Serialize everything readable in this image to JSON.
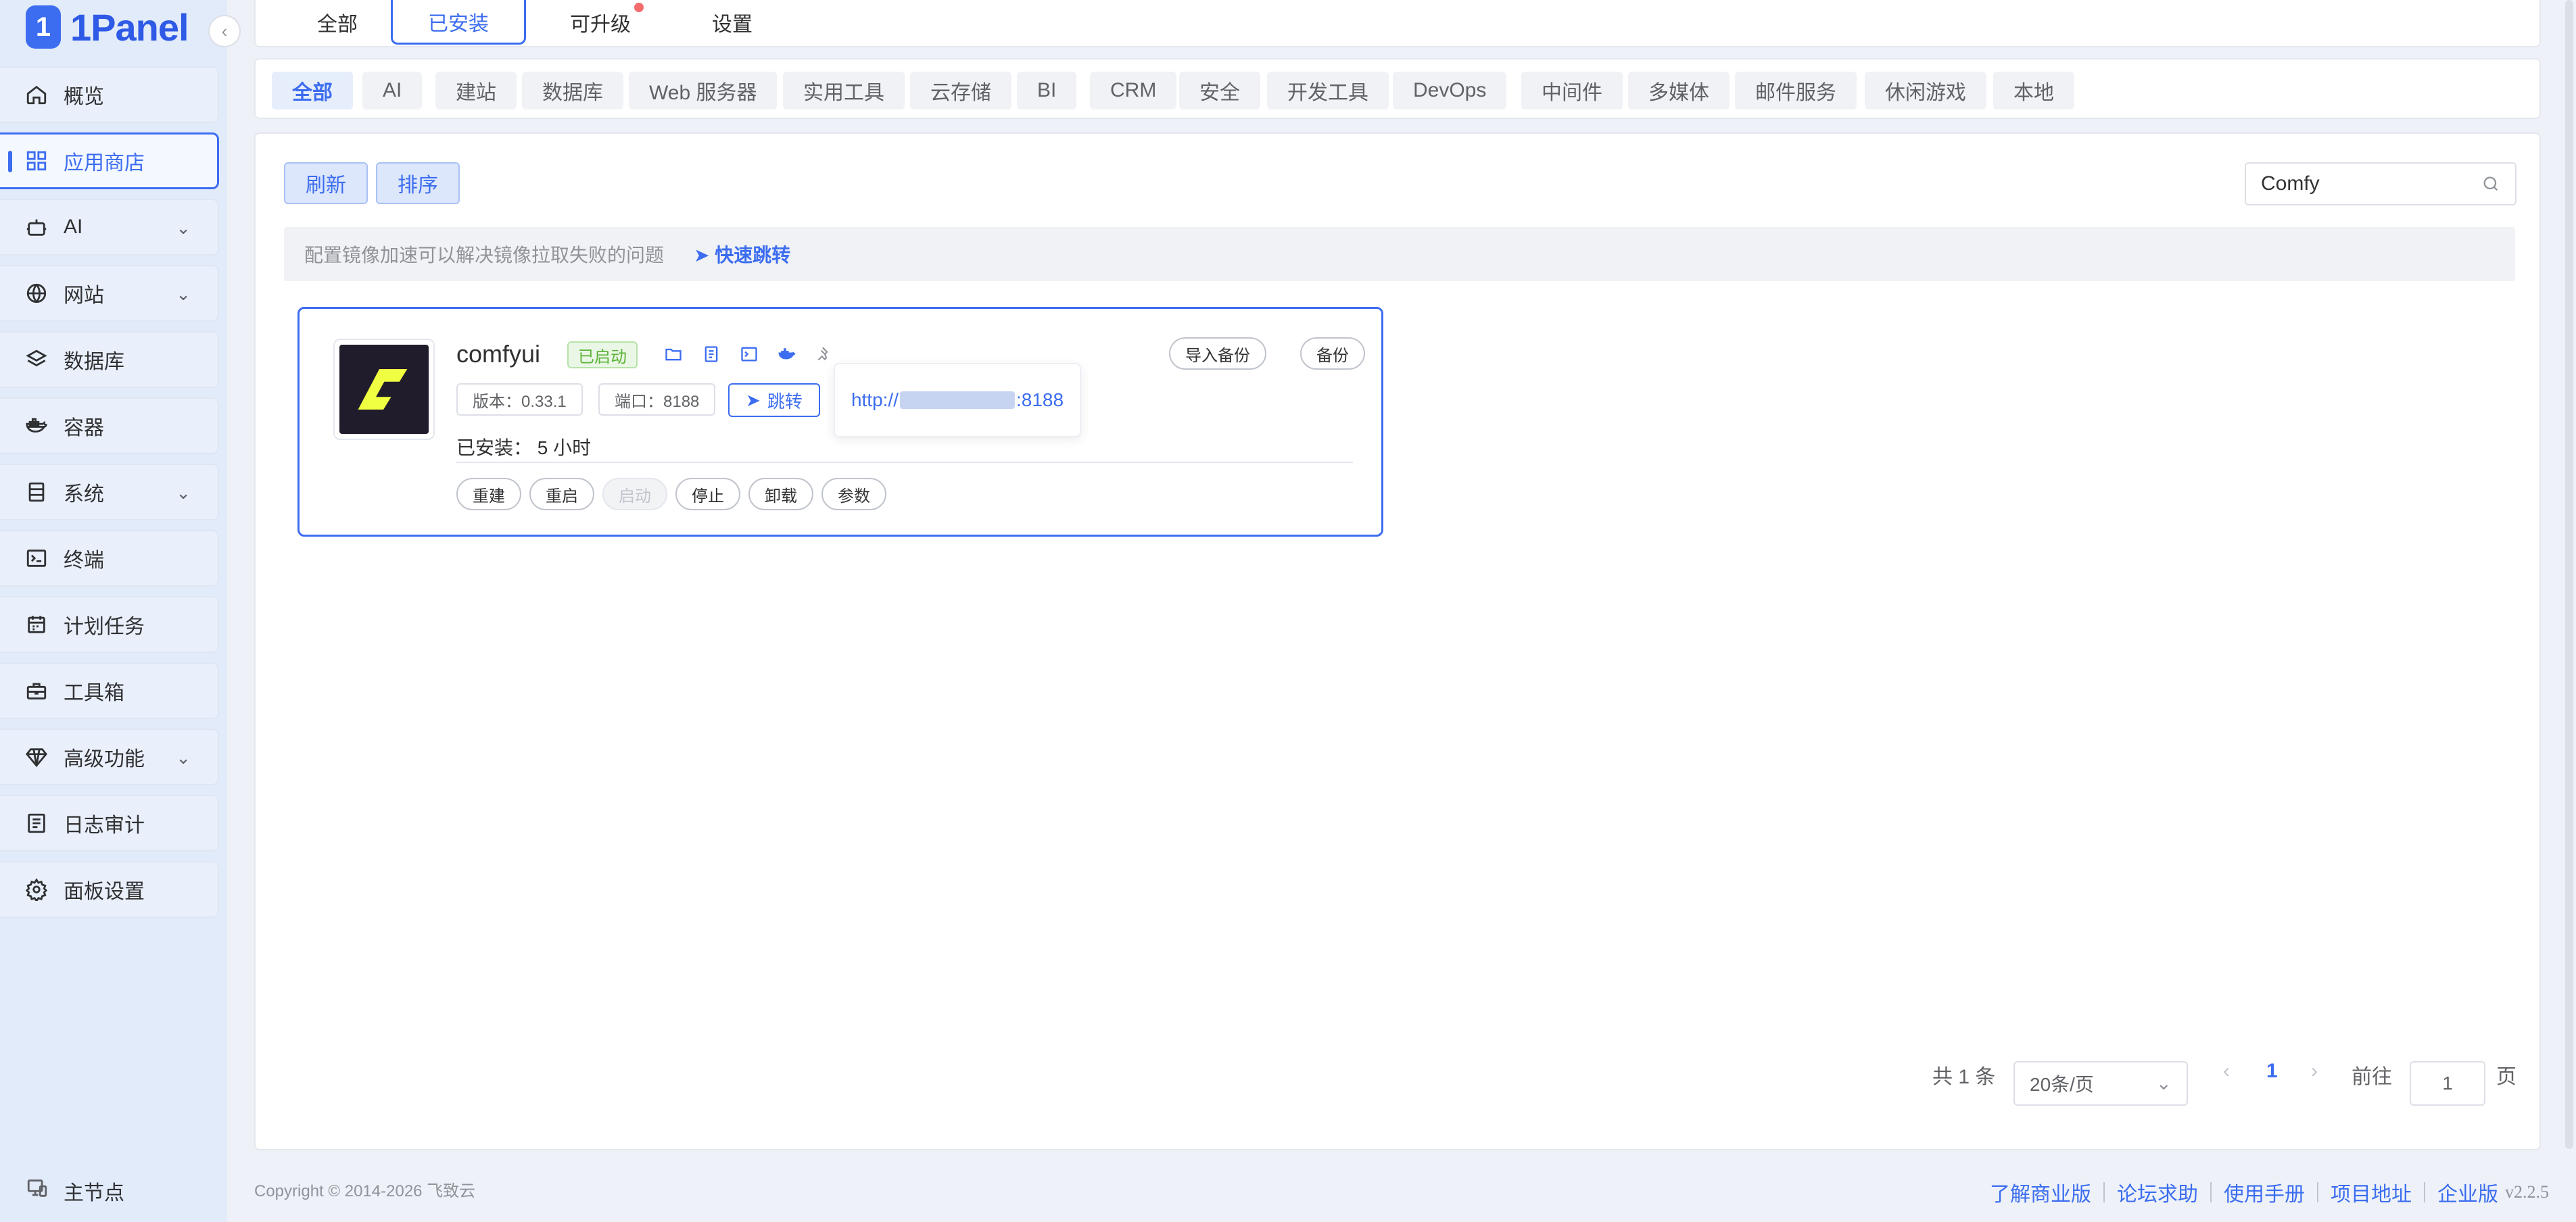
{
  "app": {
    "brand": "1Panel",
    "logo_mark": "1"
  },
  "sidebar": {
    "items": [
      {
        "label": "概览",
        "icon": "home-icon"
      },
      {
        "label": "应用商店",
        "icon": "grid-icon",
        "active": true
      },
      {
        "label": "AI",
        "icon": "robot-icon",
        "has_arrow": true
      },
      {
        "label": "网站",
        "icon": "globe-icon",
        "has_arrow": true
      },
      {
        "label": "数据库",
        "icon": "layers-icon"
      },
      {
        "label": "容器",
        "icon": "docker-icon"
      },
      {
        "label": "系统",
        "icon": "server-icon",
        "has_arrow": true
      },
      {
        "label": "终端",
        "icon": "terminal-icon"
      },
      {
        "label": "计划任务",
        "icon": "calendar-icon"
      },
      {
        "label": "工具箱",
        "icon": "toolbox-icon"
      },
      {
        "label": "高级功能",
        "icon": "diamond-icon",
        "has_arrow": true
      },
      {
        "label": "日志审计",
        "icon": "log-icon"
      },
      {
        "label": "面板设置",
        "icon": "gear-icon"
      }
    ],
    "node_label": "主节点"
  },
  "top_tabs": [
    {
      "label": "全部"
    },
    {
      "label": "已安装",
      "active": true
    },
    {
      "label": "可升级",
      "has_dot": true
    },
    {
      "label": "设置"
    }
  ],
  "categories": [
    "全部",
    "AI",
    "建站",
    "数据库",
    "Web 服务器",
    "实用工具",
    "云存储",
    "BI",
    "CRM",
    "安全",
    "开发工具",
    "DevOps",
    "中间件",
    "多媒体",
    "邮件服务",
    "休闲游戏",
    "本地"
  ],
  "toolbar": {
    "refresh_label": "刷新",
    "sort_label": "排序",
    "search_value": "Comfy"
  },
  "notice": {
    "text": "配置镜像加速可以解决镜像拉取失败的问题",
    "link": "快速跳转"
  },
  "app_card": {
    "name": "comfyui",
    "status": "已启动",
    "version_tag": "版本：0.33.1",
    "port_tag": "端口：8188",
    "jump_label": "跳转",
    "url_prefix": "http://",
    "url_suffix": ":8188",
    "installed_text": "已安装：  5 小时",
    "import_backup_label": "导入备份",
    "backup_label": "备份",
    "actions": [
      "重建",
      "重启",
      "启动",
      "停止",
      "卸载",
      "参数"
    ],
    "disabled_action": "启动"
  },
  "pagination": {
    "total": "共 1 条",
    "page_size": "20条/页",
    "current_page": "1",
    "goto_label": "前往",
    "goto_value": "1",
    "page_unit": "页"
  },
  "footer": {
    "copyright": "Copyright © 2014-2026 飞致云",
    "links": [
      "了解商业版",
      "论坛求助",
      "使用手册",
      "项目地址",
      "企业版"
    ],
    "version": "v2.2.5"
  },
  "colors": {
    "accent": "#3c6df0",
    "success": "#5cb237",
    "sidebar_bg": "#e2ebfa",
    "danger_dot": "#f56c6c"
  }
}
